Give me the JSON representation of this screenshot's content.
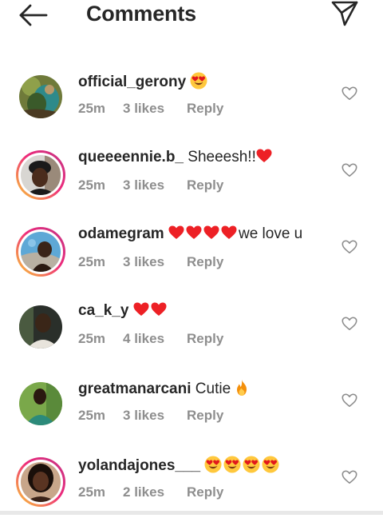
{
  "header": {
    "title": "Comments",
    "back_icon": "arrow-left-icon",
    "send_icon": "paper-plane-icon"
  },
  "colors": {
    "text": "#262626",
    "meta": "#8e8e8e",
    "heart": "#ed2025",
    "emoji_face": "#ffc83d",
    "story_ring_start": "#f9ce34",
    "story_ring_end": "#c13584"
  },
  "comments": [
    {
      "username": "official_gerony",
      "text": "",
      "emojis": [
        "heart-eyes"
      ],
      "time": "25m",
      "likes": "3 likes",
      "reply": "Reply",
      "story_ring": false
    },
    {
      "username": "queeeennie.b_",
      "text": "Sheeesh!!",
      "emojis_after": [
        "red-heart"
      ],
      "time": "25m",
      "likes": "3 likes",
      "reply": "Reply",
      "story_ring": true
    },
    {
      "username": "odamegram",
      "text": "we love u",
      "emojis_before": [
        "red-heart",
        "red-heart",
        "red-heart",
        "red-heart"
      ],
      "time": "25m",
      "likes": "3 likes",
      "reply": "Reply",
      "story_ring": true
    },
    {
      "username": "ca_k_y",
      "text": "",
      "emojis": [
        "red-heart",
        "red-heart"
      ],
      "time": "25m",
      "likes": "4 likes",
      "reply": "Reply",
      "story_ring": false
    },
    {
      "username": "greatmanarcani",
      "text": "Cutie",
      "emojis_after": [
        "fire"
      ],
      "time": "25m",
      "likes": "3 likes",
      "reply": "Reply",
      "story_ring": false
    },
    {
      "username": "yolandajones___",
      "text": "",
      "emojis": [
        "heart-eyes",
        "heart-eyes",
        "heart-eyes",
        "heart-eyes"
      ],
      "time": "25m",
      "likes": "2 likes",
      "reply": "Reply",
      "story_ring": true
    }
  ]
}
